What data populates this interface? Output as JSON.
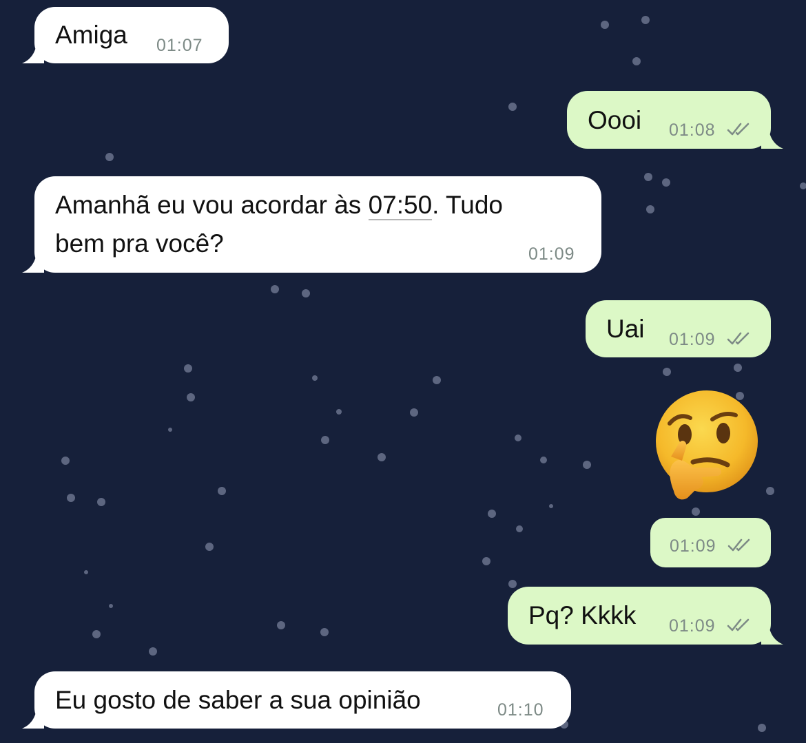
{
  "chat": {
    "messages": [
      {
        "dir": "in",
        "text": "Amiga",
        "time": "01:07"
      },
      {
        "dir": "out",
        "text": "Oooi",
        "time": "01:08",
        "status": "read-double-check-icon"
      },
      {
        "dir": "in",
        "text_line1_before": "Amanhã eu vou acordar às ",
        "text_line1_link": "07:50",
        "text_line1_after": ". Tudo",
        "text_line2": "bem pra você?",
        "time": "01:09"
      },
      {
        "dir": "out",
        "text": "Uai",
        "time": "01:09",
        "status": "read-double-check-icon"
      },
      {
        "dir": "out",
        "emoji": "thinking-face-emoji"
      },
      {
        "dir": "out",
        "time": "01:09",
        "status": "read-double-check-icon"
      },
      {
        "dir": "out",
        "text": "Pq? Kkkk",
        "time": "01:09",
        "status": "read-double-check-icon"
      },
      {
        "dir": "in",
        "text": "Eu gosto de saber a sua opinião",
        "time": "01:10"
      }
    ]
  },
  "colors": {
    "background": "#16203a",
    "incoming_bubble": "#ffffff",
    "outgoing_bubble": "#dcf8c6",
    "timestamp": "#7d8a86",
    "emoji_yellow": "#f7c336"
  }
}
